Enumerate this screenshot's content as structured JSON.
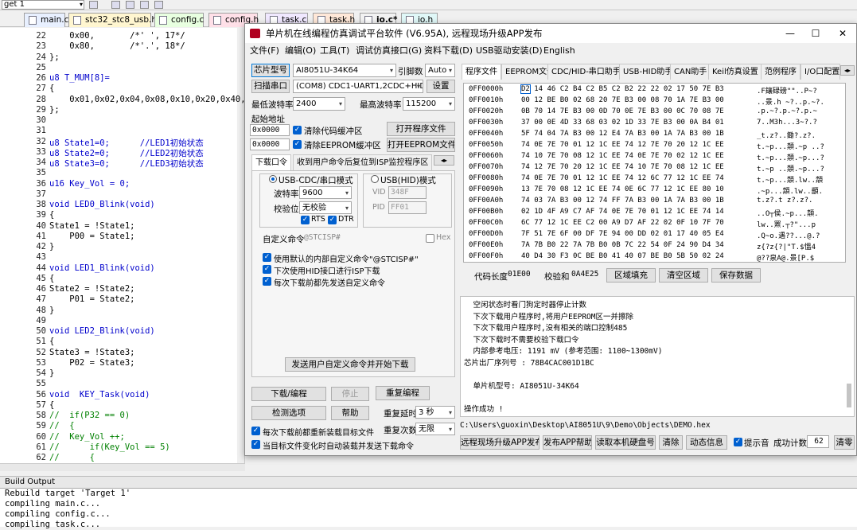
{
  "ide": {
    "target": "get 1",
    "tabs": [
      "main.c",
      "stc32_stc8_usb.h",
      "config.c",
      "config.h",
      "task.c",
      "task.h",
      "io.c*",
      "io.h"
    ],
    "tab_colors": [
      "#e8f0ff",
      "#fff6d0",
      "#e8ffe0",
      "#ffe0e8",
      "#f0e8ff",
      "#ffe8d8",
      "#f2f2f2",
      "#e0f8f8"
    ]
  },
  "code": {
    "lines": [
      [
        "22",
        "    0x00,       /*' ', 17*/"
      ],
      [
        "23",
        "    0x80,       /*'.', 18*/"
      ],
      [
        "24",
        "};"
      ],
      [
        "25",
        ""
      ],
      [
        "26",
        "u8 T_MUM[8]="
      ],
      [
        "27",
        "{"
      ],
      [
        "28",
        "    0x01,0x02,0x04,0x08,0x10,0x20,0x40,0x80,"
      ],
      [
        "29",
        "};"
      ],
      [
        "30",
        ""
      ],
      [
        "31",
        ""
      ],
      [
        "32",
        "u8 State1=0;      //LED1初始状态"
      ],
      [
        "33",
        "u8 State2=0;      //LED2初始状态"
      ],
      [
        "34",
        "u8 State3=0;      //LED3初始状态"
      ],
      [
        "35",
        ""
      ],
      [
        "36",
        "u16 Key_Vol = 0;"
      ],
      [
        "37",
        ""
      ],
      [
        "38",
        "void LED0_Blink(void)"
      ],
      [
        "39",
        "{"
      ],
      [
        "40",
        "State1 = !State1;"
      ],
      [
        "41",
        "    P00 = State1;"
      ],
      [
        "42",
        "}"
      ],
      [
        "43",
        ""
      ],
      [
        "44",
        "void LED1_Blink(void)"
      ],
      [
        "45",
        "{"
      ],
      [
        "46",
        "State2 = !State2;"
      ],
      [
        "47",
        "    P01 = State2;"
      ],
      [
        "48",
        "}"
      ],
      [
        "49",
        ""
      ],
      [
        "50",
        "void LED2_Blink(void)"
      ],
      [
        "51",
        "{"
      ],
      [
        "52",
        "State3 = !State3;"
      ],
      [
        "53",
        "    P02 = State3;"
      ],
      [
        "54",
        "}"
      ],
      [
        "55",
        ""
      ],
      [
        "56",
        "void  KEY_Task(void)"
      ],
      [
        "57",
        "{"
      ],
      [
        "58",
        "//  if(P32 == 0)"
      ],
      [
        "59",
        "//  {"
      ],
      [
        "60",
        "//  Key_Vol ++;"
      ],
      [
        "61",
        "//      if(Key_Vol == 5)"
      ],
      [
        "62",
        "//      {"
      ]
    ]
  },
  "build": {
    "title": "Build Output",
    "lines": [
      "Rebuild target 'Target 1'",
      "compiling main.c...",
      "compiling config.c...",
      "compiling task.c..."
    ]
  },
  "isp": {
    "title": "单片机在线编程仿真调试平台软件 (V6.95A), 远程现场升级APP发布",
    "menu": [
      "文件(F)",
      "编辑(O)",
      "工具(T)",
      "调试仿真接口(G)",
      "资料下载(D)",
      "USB驱动安装(D)",
      "English"
    ],
    "chip_label": "芯片型号",
    "chip_value": "AI8051U-34K64",
    "pin_label": "引脚数",
    "pin_value": "Auto",
    "scan_button": "扫描串口",
    "port_value": "(COM8) CDC1-UART1,2CDC+HID",
    "settings_button": "设置",
    "min_baud_label": "最低波特率",
    "min_baud": "2400",
    "max_baud_label": "最高波特率",
    "max_baud": "115200",
    "start_addr_label": "起始地址",
    "addr1": "0x0000",
    "clear_code": "清除代码缓冲区",
    "open_prog": "打开程序文件",
    "addr2": "0x0000",
    "clear_eeprom": "清除EEPROM缓冲区",
    "open_eeprom": "打开EEPROM文件",
    "left_tabs": [
      "下载口令",
      "收到用户命令后复位到ISP监控程序区"
    ],
    "mode_cdc": "USB-CDC/串口模式",
    "mode_hid": "USB(HID)模式",
    "baud_label": "波特率",
    "baud_value": "9600",
    "parity_label": "校验位",
    "parity_value": "无校验",
    "rts": "RTS",
    "dtr": "DTR",
    "vid_label": "VID",
    "vid_value": "348F",
    "pid_label": "PID",
    "pid_value": "FF01",
    "custom_cmd_label": "自定义命令",
    "custom_cmd_value": "@STCISP#",
    "hex_label": "Hex",
    "opt1": "使用默认的内部自定义命令\"@STCISP#\"",
    "opt2": "下次使用HID接口进行ISP下载",
    "opt3": "每次下载前都先发送自定义命令",
    "send_cmd_button": "发送用户自定义命令并开始下载",
    "download_button": "下载/编程",
    "stop_button": "停止",
    "reprogram_button": "重复编程",
    "detect_button": "检测选项",
    "help_button": "帮助",
    "delay_label": "重复延时",
    "delay_value": "3 秒",
    "reload_label": "每次下载前都重新装载目标文件",
    "repeat_count_label": "重复次数",
    "repeat_count_value": "无限",
    "auto_label": "当目标文件变化时自动装载并发送下载命令",
    "right_tabs": [
      "程序文件",
      "EEPROM文件",
      "CDC/HID-串口助手",
      "USB-HID助手",
      "CAN助手",
      "Keil仿真设置",
      "范例程序",
      "I/O口配置"
    ],
    "hex_rows": [
      [
        "0FF0000h",
        "D2 14 46 C2 B4 C2 B5 C2 B2 22 22 02 17 50 7E B3",
        ".F鑲碌磅\"\"..P~?"
      ],
      [
        "0FF0010h",
        "00 12 BE B0 02 68 20 7E B3 00 08 70 1A 7E B3 00",
        "..景.h ~?..p.~?."
      ],
      [
        "0FF0020h",
        "0B 70 14 7E B3 00 0D 70 0E 7E B3 00 0C 70 08 7E",
        ".p.~?.p.~?.p.~"
      ],
      [
        "0FF0030h",
        "37 00 0E 4D 33 68 03 02 1D 33 7E B3 00 0A B4 01",
        "7..M3h...3~?.?"
      ],
      [
        "0FF0040h",
        "5F 74 04 7A B3 00 12 E4 7A B3 00 1A 7A B3 00 1B",
        "_t.z?..鋤?.z?."
      ],
      [
        "0FF0050h",
        "74 0E 7E 70 01 12 1C EE 74 12 7E 70 20 12 1C EE",
        "t.~p...頮.~p ..?"
      ],
      [
        "0FF0060h",
        "74 10 7E 70 08 12 1C EE 74 0E 7E 70 02 12 1C EE",
        "t.~p...頮.~p...?"
      ],
      [
        "0FF0070h",
        "74 12 7E 70 20 12 1C EE 74 10 7E 70 08 12 1C EE",
        "t.~p ..頮.~p...?"
      ],
      [
        "0FF0080h",
        "74 0E 7E 70 01 12 1C EE 74 12 6C 77 12 1C EE 74",
        "t.~p...頮.lw..頮"
      ],
      [
        "0FF0090h",
        "13 7E 70 08 12 1C EE 74 0E 6C 77 12 1C EE 80 10",
        ".~p...頮.lw..顲."
      ],
      [
        "0FF00A0h",
        "74 03 7A B3 00 12 74 FF 7A B3 00 1A 7A B3 00 1B",
        "t.z?.t z?.z?."
      ],
      [
        "0FF00B0h",
        "02 1D 4F A9 C7 AF 74 0E 7E 70 01 12 1C EE 74 14",
        "..O┬侯.~p...頮."
      ],
      [
        "0FF00C0h",
        "6C 77 12 1C EE C2 00 A9 D7 AF 22 02 0F 10 7F 70",
        "lw..罴.┬?\"...p"
      ],
      [
        "0FF00D0h",
        "7F 51 7E 6F 00 DF 7E 94 00 DD 02 01 17 40 05 E4",
        ".Q~o.遇??...@.?"
      ],
      [
        "0FF00E0h",
        "7A 7B B0 22 7A 7B B0 0B 7C 22 54 0F 24 90 D4 34",
        "z{?z{?|\"T.$慍4"
      ],
      [
        "0FF00F0h",
        "40 D4 30 F3 0C BE B0 41 40 07 BE B0 5B 50 02 24",
        "@??泉A@.景[P.$"
      ]
    ],
    "code_len_label": "代码长度",
    "code_len": "01E00",
    "checksum_label": "校验和",
    "checksum": "0A4E25",
    "fill_button": "区域填充",
    "clear_area_button": "清空区域",
    "save_button": "保存数据",
    "log": [
      "  空闲状态时看门狗定时器停止计数",
      "  下次下载用户程序时,将用户EEPROM区一并擦除",
      "  下次下载用户程序时,没有相关的端口控制485",
      "  下次下载时不需要校验下载口令",
      "  内部参考电压: 1191 mV (参考范围: 1100~1300mV)",
      "芯片出厂序列号 : 78B4CAC001D1BC",
      "",
      "  单片机型号: AI8051U-34K64",
      "",
      "操作成功 !"
    ],
    "path": "C:\\Users\\guoxin\\Desktop\\AI8051U\\9\\Demo\\Objects\\DEMO.hex",
    "bottom": {
      "publish": "远程现场升级APP发布",
      "publish_help": "发布APP帮助",
      "read_disk": "读取本机硬盘号",
      "clear": "清除",
      "dynamic": "动态信息",
      "beep": "提示音",
      "success_label": "成功计数",
      "success_count": "62",
      "clear2": "清零"
    }
  }
}
